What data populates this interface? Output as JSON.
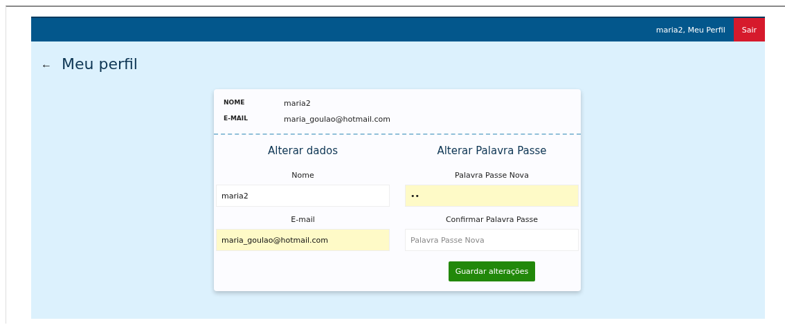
{
  "header": {
    "user_link": "maria2, Meu Perfil",
    "logout_button": "Sair"
  },
  "page": {
    "back": "←",
    "title": "Meu perfil"
  },
  "profile": [
    {
      "label": "NOME",
      "value": "maria2"
    },
    {
      "label": "E-MAIL",
      "value": "maria_goulao@hotmail.com"
    }
  ],
  "forms": [
    {
      "title": "Alterar dados",
      "fields": [
        {
          "label": "Nome",
          "value": "maria2",
          "autofilled": false
        },
        {
          "label": "E-mail",
          "value": "maria_goulao@hotmail.com",
          "autofilled": true
        }
      ]
    },
    {
      "title": "Alterar Palavra Passe",
      "fields": [
        {
          "label": "Palavra Passe Nova",
          "value": "••",
          "autofilled": true
        },
        {
          "label": "Confirmar Palavra Passe",
          "placeholder": "Palavra Passe Nova",
          "autofilled": false
        }
      ],
      "button": "Guardar alterações"
    }
  ]
}
